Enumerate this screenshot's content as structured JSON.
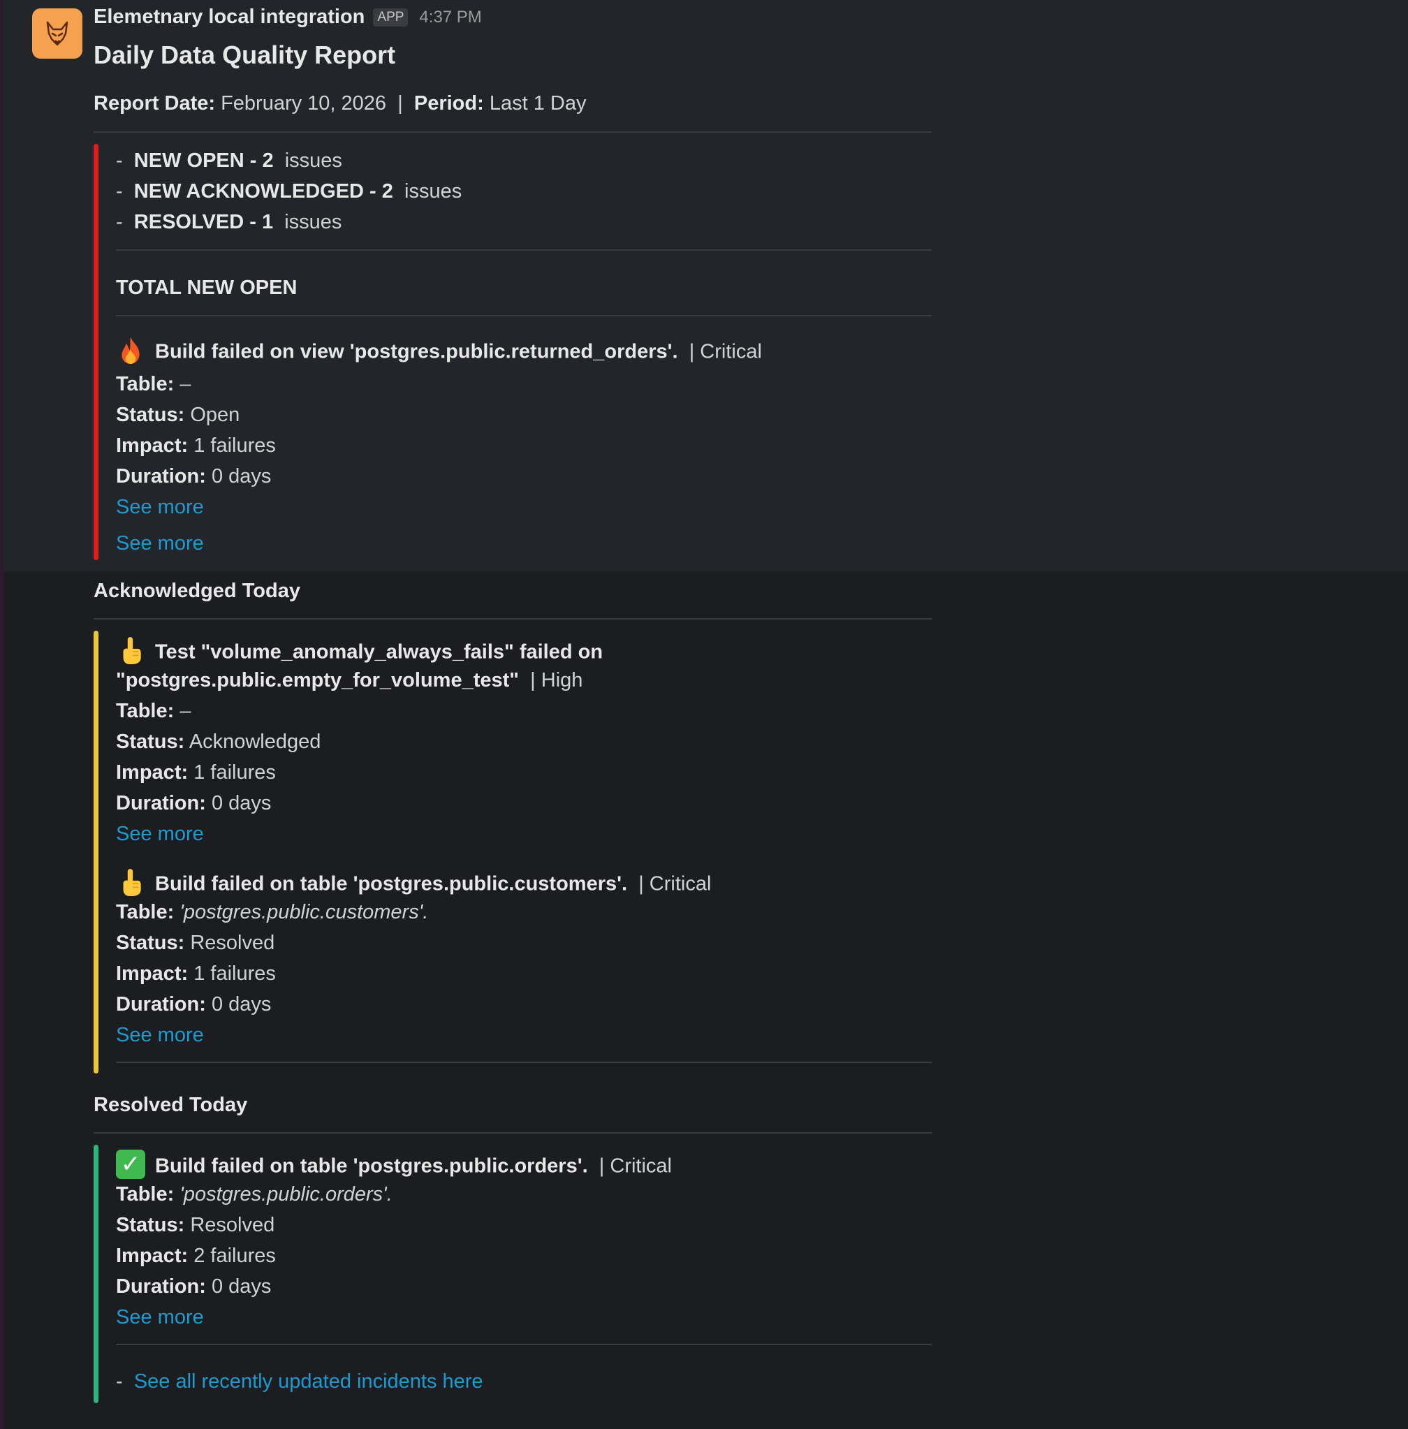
{
  "message": {
    "sender": "Elemetnary local integration",
    "badge": "APP",
    "time": "4:37 PM",
    "avatar_icon": "fox-logo-icon",
    "title": "Daily Data Quality Report"
  },
  "report_meta": {
    "report_date_label": "Report Date:",
    "report_date_value": "February 10, 2026",
    "separator": "|",
    "period_label": "Period:",
    "period_value": "Last 1 Day"
  },
  "summary": {
    "items": [
      {
        "dash": "-",
        "label": "NEW OPEN - 2",
        "suffix": "issues"
      },
      {
        "dash": "-",
        "label": "NEW ACKNOWLEDGED - 2",
        "suffix": "issues"
      },
      {
        "dash": "-",
        "label": "RESOLVED - 1",
        "suffix": "issues"
      }
    ]
  },
  "open_section": {
    "heading": "TOTAL NEW OPEN",
    "bar_color": "#e01e1e",
    "incident": {
      "emoji": "fire-icon",
      "title": "Build failed on view 'postgres.public.returned_orders'.",
      "severity": "| Critical",
      "table_label": "Table:",
      "table_value": "–",
      "status_label": "Status:",
      "status_value": "Open",
      "impact_label": "Impact:",
      "impact_value": "1 failures",
      "duration_label": "Duration:",
      "duration_value": "0 days",
      "see_more": "See more"
    },
    "see_more_footer": "See more"
  },
  "ack_section": {
    "heading": "Acknowledged Today",
    "bar_color": "#ecc53a",
    "incidents": [
      {
        "emoji": "pointing-up-hand-icon",
        "title_line1": "Test \"volume_anomaly_always_fails\" failed on",
        "title_line2": "\"postgres.public.empty_for_volume_test\"",
        "severity": "| High",
        "table_label": "Table:",
        "table_value": "–",
        "status_label": "Status:",
        "status_value": "Acknowledged",
        "impact_label": "Impact:",
        "impact_value": "1 failures",
        "duration_label": "Duration:",
        "duration_value": "0 days",
        "see_more": "See more"
      },
      {
        "emoji": "pointing-up-hand-icon",
        "title": "Build failed on table 'postgres.public.customers'.",
        "severity": "| Critical",
        "table_label": "Table:",
        "table_value": "'postgres.public.customers'.",
        "status_label": "Status:",
        "status_value": "Resolved",
        "impact_label": "Impact:",
        "impact_value": "1 failures",
        "duration_label": "Duration:",
        "duration_value": "0 days",
        "see_more": "See more"
      }
    ]
  },
  "resolved_section": {
    "heading": "Resolved Today",
    "bar_color": "#2eb67d",
    "incident": {
      "emoji": "check-mark-icon",
      "title": "Build failed on table 'postgres.public.orders'.",
      "severity": "| Critical",
      "table_label": "Table:",
      "table_value": "'postgres.public.orders'.",
      "status_label": "Status:",
      "status_value": "Resolved",
      "impact_label": "Impact:",
      "impact_value": "2 failures",
      "duration_label": "Duration:",
      "duration_value": "0 days",
      "see_more": "See more"
    },
    "footer_dash": "-",
    "footer_link": "See all recently updated incidents here"
  }
}
